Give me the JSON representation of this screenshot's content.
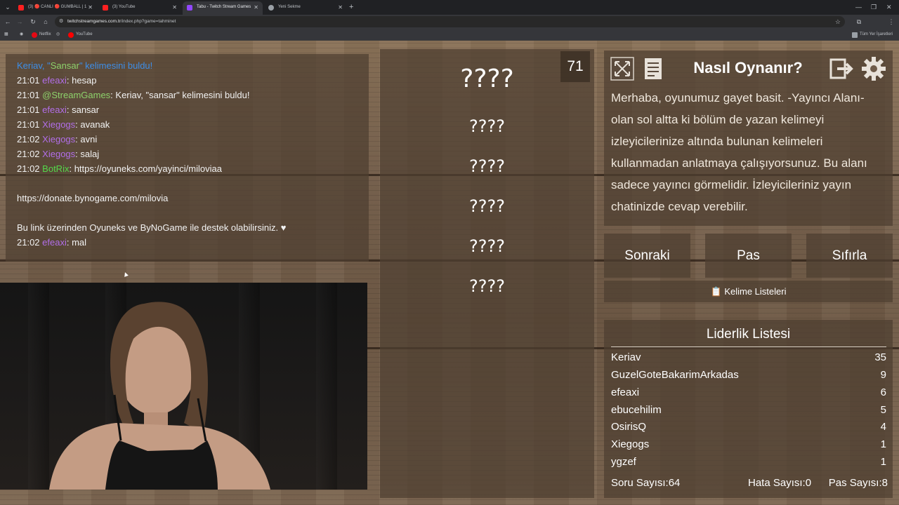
{
  "browser": {
    "tabs": [
      {
        "label": "(3) 🔴 CANLI 🔴 GUMBALL | 1",
        "fav_color": "#ff2020",
        "active": false
      },
      {
        "label": "(3) YouTube",
        "fav_color": "#ff2020",
        "active": false
      },
      {
        "label": "Tabu - Twitch Stream Games",
        "fav_color": "#9147ff",
        "active": true
      },
      {
        "label": "Yeni Sekme",
        "fav_color": "#9aa0a6",
        "active": false
      }
    ],
    "new_tab": "+",
    "url_host": "twitchstreamgames.com.tr",
    "url_path": "/index.php?game=tahminet",
    "bookmarks": [
      {
        "label": "Netflix",
        "color": "#e50914"
      },
      {
        "label": "YouTube",
        "color": "#ff0000"
      }
    ],
    "all_bookmarks": "Tüm Yer İşaretleri"
  },
  "chat": {
    "lines": [
      {
        "time": "",
        "user": "",
        "user_color": "#3d8ee8",
        "text": "Keriav, \"Sansar\" kelimesini buldu!",
        "highlight": "Sansar"
      },
      {
        "time": "21:01",
        "user": "efeaxi",
        "user_color": "#b16ee8",
        "text": ": hesap"
      },
      {
        "time": "21:01",
        "user": "@StreamGames",
        "user_color": "#8dd26b",
        "text": ": Keriav, \"sansar\" kelimesini buldu!"
      },
      {
        "time": "21:01",
        "user": "efeaxi",
        "user_color": "#b16ee8",
        "text": ": sansar"
      },
      {
        "time": "21:01",
        "user": "Xiegogs",
        "user_color": "#b16ee8",
        "text": ": avanak"
      },
      {
        "time": "21:02",
        "user": "Xiegogs",
        "user_color": "#b16ee8",
        "text": ": avni"
      },
      {
        "time": "21:02",
        "user": "Xiegogs",
        "user_color": "#b16ee8",
        "text": ": salaj"
      },
      {
        "time": "21:02",
        "user": "BotRix",
        "user_color": "#54d94a",
        "text": ": https://oyuneks.com/yayinci/miloviaa"
      },
      {
        "blank": true
      },
      {
        "time": "",
        "user": "",
        "user_color": "#f2f2f2",
        "text": "https://donate.bynogame.com/milovia"
      },
      {
        "blank": true
      },
      {
        "time": "",
        "user": "",
        "user_color": "#f2f2f2",
        "text": "Bu link üzerinden Oyuneks ve ByNoGame ile destek olabilirsiniz. ♥"
      },
      {
        "time": "21:02",
        "user": "efeaxi",
        "user_color": "#b16ee8",
        "text": ": mal"
      }
    ]
  },
  "game": {
    "timer": "71",
    "words": [
      "????",
      "????",
      "????",
      "????",
      "????",
      "????"
    ]
  },
  "howto": {
    "title": "Nasıl Oynanır?",
    "text": "Merhaba, oyunumuz gayet basit. -Yayıncı Alanı- olan sol altta ki bölüm de yazan kelimeyi izleyicilerinize altında bulunan kelimeleri kullanmadan anlatmaya çalışıyorsunuz. Bu alanı sadece yayıncı görmelidir. İzleyicileriniz yayın chatinizde cevap verebilir."
  },
  "buttons": {
    "next": "Sonraki",
    "pass": "Pas",
    "reset": "Sıfırla",
    "word_lists": "📋 Kelime Listeleri"
  },
  "leaderboard": {
    "title": "Liderlik Listesi",
    "rows": [
      {
        "name": "Keriav",
        "score": "35"
      },
      {
        "name": "GuzelGoteBakarimArkadas",
        "score": "9"
      },
      {
        "name": "efeaxi",
        "score": "6"
      },
      {
        "name": "ebucehilim",
        "score": "5"
      },
      {
        "name": "OsirisQ",
        "score": "4"
      },
      {
        "name": "Xiegogs",
        "score": "1"
      },
      {
        "name": "ygzef",
        "score": "1"
      }
    ],
    "stats": {
      "questions": "Soru Sayısı:64",
      "errors": "Hata Sayısı:0",
      "passes": "Pas Sayısı:8"
    }
  }
}
